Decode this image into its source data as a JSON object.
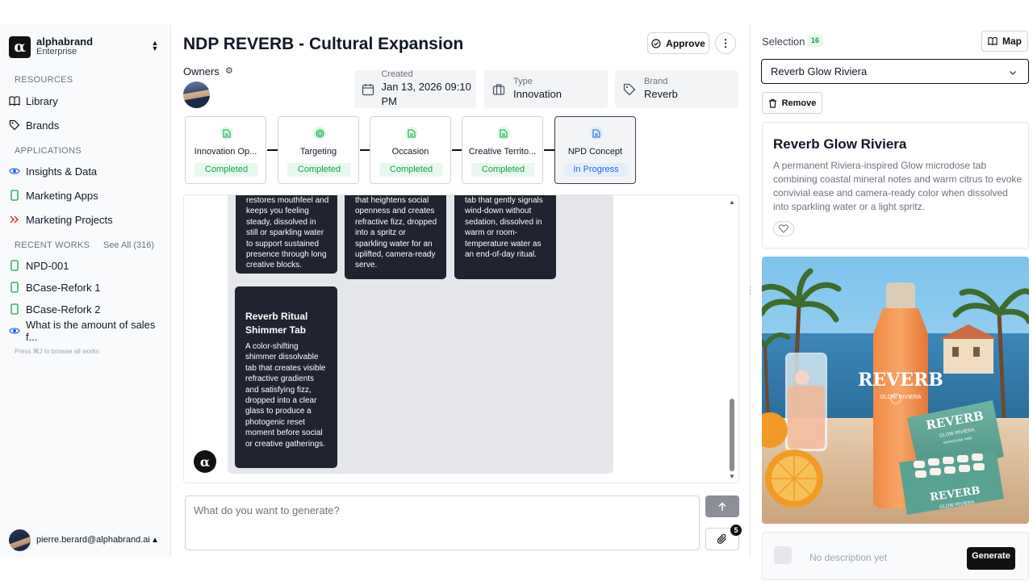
{
  "sidebar": {
    "brand": {
      "name": "alphabrand",
      "plan": "Enterprise",
      "logo": "α"
    },
    "sections": {
      "resources": "RESOURCES",
      "applications": "APPLICATIONS",
      "recent": "RECENT WORKS"
    },
    "resources": [
      {
        "label": "Library",
        "icon": "book-icon"
      },
      {
        "label": "Brands",
        "icon": "tag-icon"
      }
    ],
    "applications": [
      {
        "label": "Insights & Data",
        "icon": "eye-icon"
      },
      {
        "label": "Marketing Apps",
        "icon": "phone-icon"
      },
      {
        "label": "Marketing Projects",
        "icon": "double-chevron-icon"
      }
    ],
    "see_all": "See All (316)",
    "recent": [
      {
        "label": "NPD-001"
      },
      {
        "label": "BCase-Refork 1"
      },
      {
        "label": "BCase-Refork 2"
      },
      {
        "label": "What is the amount of sales f..."
      }
    ],
    "hint": "Press ⌘J to browse all works",
    "user_email": "pierre.berard@alphabrand.ai"
  },
  "header": {
    "title": "NDP REVERB - Cultural Expansion",
    "approve_label": "Approve",
    "more_label": "⋮",
    "owners_label": "Owners"
  },
  "meta": {
    "created": {
      "label": "Created",
      "value": "Jan 13, 2026 09:10 PM"
    },
    "type": {
      "label": "Type",
      "value": "Innovation"
    },
    "brand": {
      "label": "Brand",
      "value": "Reverb"
    }
  },
  "steps": [
    {
      "name": "Innovation Op...",
      "status": "Completed"
    },
    {
      "name": "Targeting",
      "status": "Completed"
    },
    {
      "name": "Occasion",
      "status": "Completed"
    },
    {
      "name": "Creative Territo...",
      "status": "Completed"
    },
    {
      "name": "NPD Concept",
      "status": "In Progress"
    }
  ],
  "chat": {
    "cards": [
      {
        "desc": "restores mouthfeel and keeps you feeling steady, dissolved in still or sparkling water to support sustained presence through long creative blocks."
      },
      {
        "desc": "that heightens social openness and creates refractive fizz, dropped into a spritz or sparkling water for an uplifted, camera-ready serve."
      },
      {
        "desc": "tab that gently signals wind-down without sedation, dissolved in warm or room-temperature water as an end-of-day ritual."
      },
      {
        "title": "Reverb Ritual Shimmer Tab",
        "desc": "A color-shifting shimmer dissolvable tab that creates visible refractive gradients and satisfying fizz, dropped into a clear glass to produce a photogenic reset moment before social or creative gatherings."
      }
    ],
    "bot_logo": "α"
  },
  "composer": {
    "placeholder": "What do you want to generate?",
    "attachments_count": "5"
  },
  "right_panel": {
    "selection_label": "Selection",
    "selection_count": "16",
    "map_label": "Map",
    "selected_value": "Reverb Glow Riviera",
    "remove_label": "Remove",
    "detail": {
      "title": "Reverb Glow Riviera",
      "description": "A permanent Riviera-inspired Glow microdose tab combining coastal mineral notes and warm citrus to evoke convivial ease and camera-ready color when dissolved into sparkling water or a light spritz."
    },
    "product_image": {
      "bottle_brand": "REVERB",
      "bottle_sub": "GLOW RIVIERA",
      "tin_brand": "REVERB",
      "tin_sub": "GLOW RIVIERA",
      "tin_small": "MICRODOSE TABS",
      "front_brand": "REVERB",
      "front_sub": "GLOW RIVIERA"
    },
    "bottom": {
      "no_description": "No description yet",
      "generate_label": "Generate"
    }
  },
  "colors": {
    "completed": "#16a34a",
    "in_progress": "#2563eb",
    "card_bg": "#1f2430",
    "accent_dark": "#111111"
  }
}
